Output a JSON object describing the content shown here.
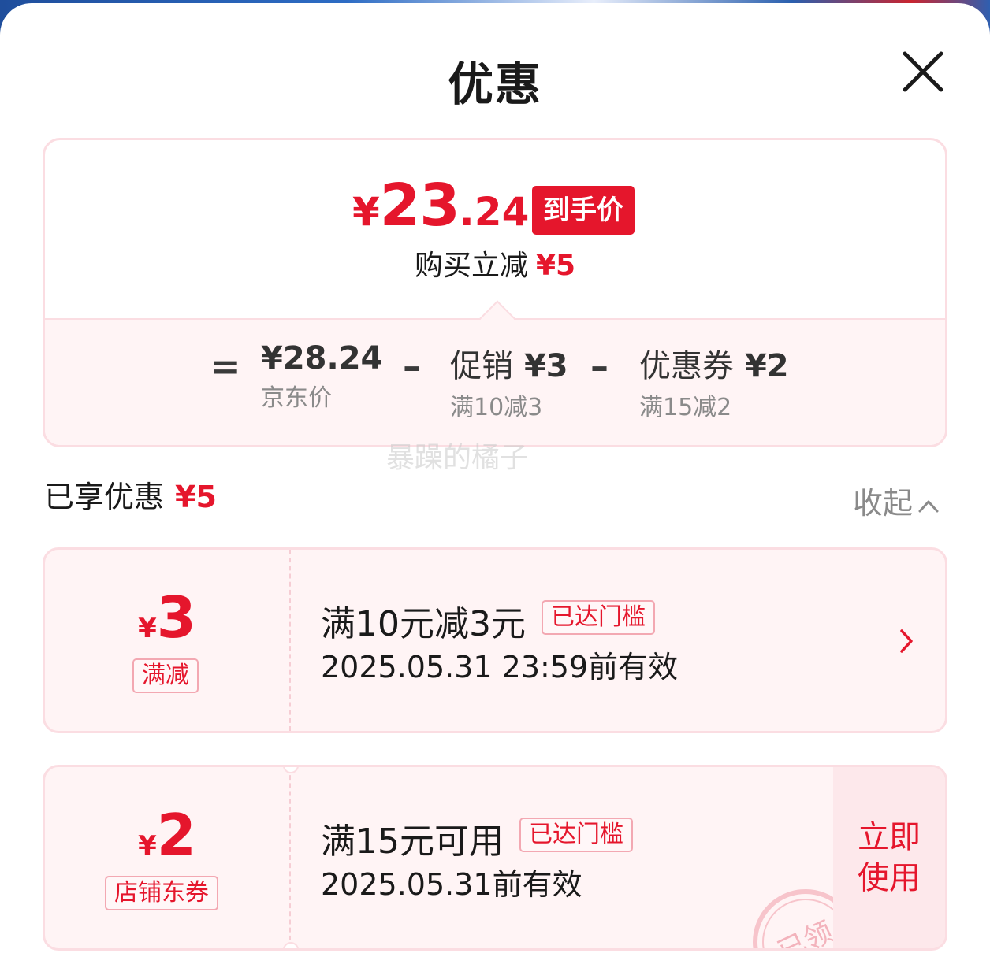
{
  "header": {
    "title": "优惠"
  },
  "summary": {
    "yen": "¥",
    "price_int": "23",
    "price_dec": ".24",
    "final_tag": "到手价",
    "reduce_label": "购买立减",
    "reduce_amount": "¥5",
    "equals": "=",
    "minus": "–",
    "jd_price": "¥28.24",
    "jd_price_label": "京东价",
    "promo_label": "促销",
    "promo_amount": "¥3",
    "promo_rule": "满10减3",
    "coupon_label": "优惠券",
    "coupon_amount": "¥2",
    "coupon_rule": "满15减2"
  },
  "watermark": "暴躁的橘子",
  "enjoyed": {
    "label": "已享优惠",
    "amount": "¥5",
    "collapse_label": "收起"
  },
  "coupons": [
    {
      "yen": "¥",
      "amount": "3",
      "type": "满减",
      "title": "满10元减3元",
      "badge": "已达门槛",
      "valid": "2025.05.31 23:59前有效"
    },
    {
      "yen": "¥",
      "amount": "2",
      "type": "店铺东券",
      "title": "满15元可用",
      "badge": "已达门槛",
      "valid": "2025.05.31前有效",
      "action": "立即使用",
      "stamp": "已领"
    }
  ],
  "colors": {
    "accent": "#e5162c",
    "card_border": "#fbdde2",
    "card_bg": "#fff4f5"
  }
}
